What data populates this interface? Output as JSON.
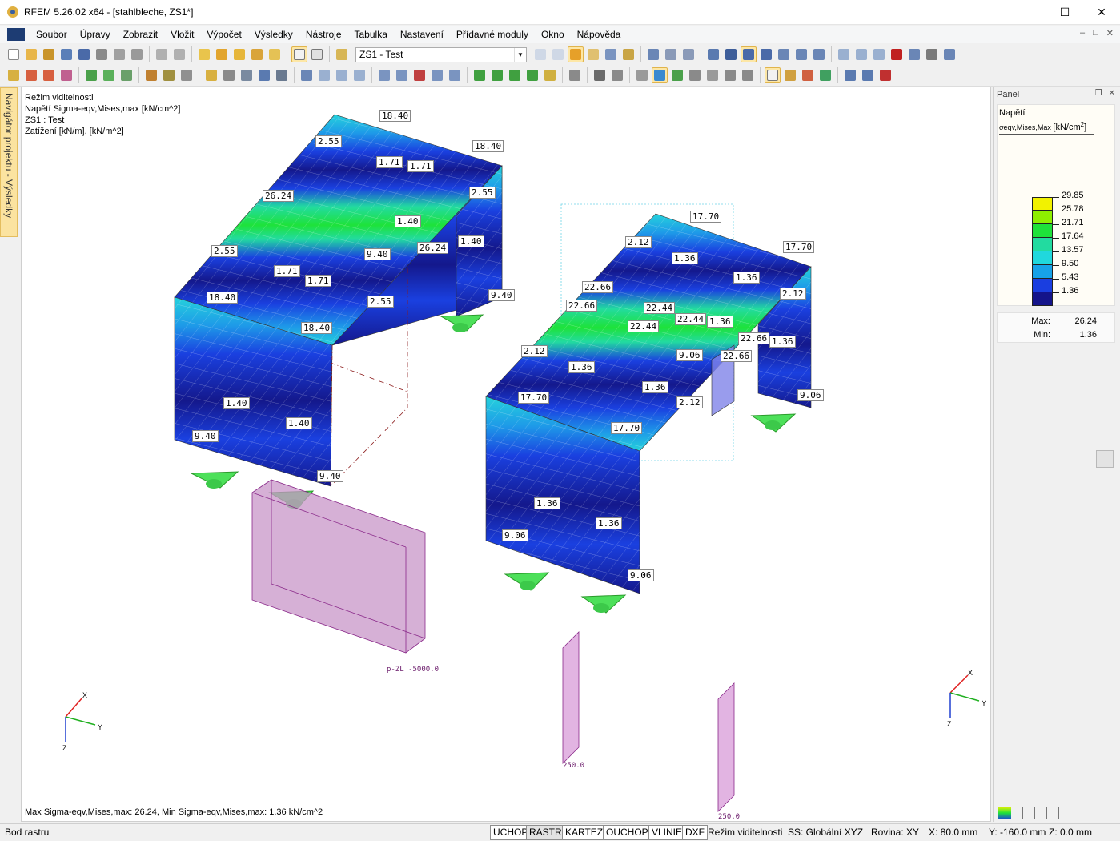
{
  "window": {
    "title": "RFEM 5.26.02 x64 - [stahlbleche, ZS1*]",
    "minimize": "—",
    "maximize": "☐",
    "close": "✕"
  },
  "menu": {
    "items": [
      "Soubor",
      "Úpravy",
      "Zobrazit",
      "Vložit",
      "Výpočet",
      "Výsledky",
      "Nástroje",
      "Tabulka",
      "Nastavení",
      "Přídavné moduly",
      "Okno",
      "Nápověda"
    ],
    "mdi_controls": [
      "–",
      "□",
      "✕"
    ]
  },
  "toolbar": {
    "load_case": "ZS1 - Test",
    "icon_color_a": "#4a7fc1",
    "icon_color_b": "#d9a43a"
  },
  "navigator": {
    "tab_label": "Navigátor projektu - Výsledky"
  },
  "viewport": {
    "info_lines": [
      "Režim viditelnosti",
      "Napětí Sigma-eqv,Mises,max [kN/cm^2]",
      "ZS1 : Test",
      "Zatížení [kN/m], [kN/m^2]"
    ],
    "bottom_text": "Max Sigma-eqv,Mises,max: 26.24, Min Sigma-eqv,Mises,max: 1.36 kN/cm^2",
    "load_labels": {
      "area": "p-ZL -5000.0",
      "line_a": "250.0",
      "line_b": "250.0"
    },
    "axis": {
      "x": "X",
      "y": "Y",
      "z": "Z"
    },
    "result_labels": {
      "left": [
        "18.40",
        "18.40",
        "2.55",
        "1.71",
        "1.71",
        "2.55",
        "26.24",
        "1.40",
        "1.40",
        "26.24",
        "9.40",
        "2.55",
        "1.71",
        "1.71",
        "18.40",
        "2.55",
        "9.40",
        "18.40",
        "1.40",
        "1.40",
        "9.40",
        "9.40"
      ],
      "right": [
        "17.70",
        "17.70",
        "2.12",
        "1.36",
        "1.36",
        "2.12",
        "22.66",
        "22.66",
        "22.44",
        "22.44",
        "22.44",
        "1.36",
        "22.66",
        "1.36",
        "2.12",
        "1.36",
        "9.06",
        "22.66",
        "1.36",
        "2.12",
        "17.70",
        "17.70",
        "1.36",
        "1.36",
        "9.06",
        "9.06",
        "9.06"
      ]
    }
  },
  "panel": {
    "title": "Panel",
    "pin": "❒",
    "close": "✕",
    "result_name": "Napětí",
    "result_sub": "σeqv,Mises,Max",
    "result_unit": "[kN/cm",
    "result_unit_sup": "2",
    "result_unit_end": "]",
    "scale": {
      "values": [
        "29.85",
        "25.78",
        "21.71",
        "17.64",
        "13.57",
        "9.50",
        "5.43",
        "1.36"
      ],
      "colors": [
        "#f2f200",
        "#8ef000",
        "#1ee23a",
        "#22dba0",
        "#20d8dd",
        "#17a2e8",
        "#1a3ee0",
        "#14148a"
      ]
    },
    "max_label": "Max:",
    "max_value": "26.24",
    "min_label": "Min:",
    "min_value": "1.36"
  },
  "status": {
    "left": "Bod rastru",
    "buttons": [
      "UCHOP",
      "RASTR",
      "KARTEZ",
      "OUCHOP",
      "VLINIE",
      "DXF"
    ],
    "active": "RASTR",
    "mode": "Režim viditelnosti",
    "cs": "SS: Globální XYZ",
    "plane": "Rovina: XY",
    "x": "X:  80.0 mm",
    "y": "Y:  -160.0 mm",
    "z": "Z:  0.0 mm"
  }
}
